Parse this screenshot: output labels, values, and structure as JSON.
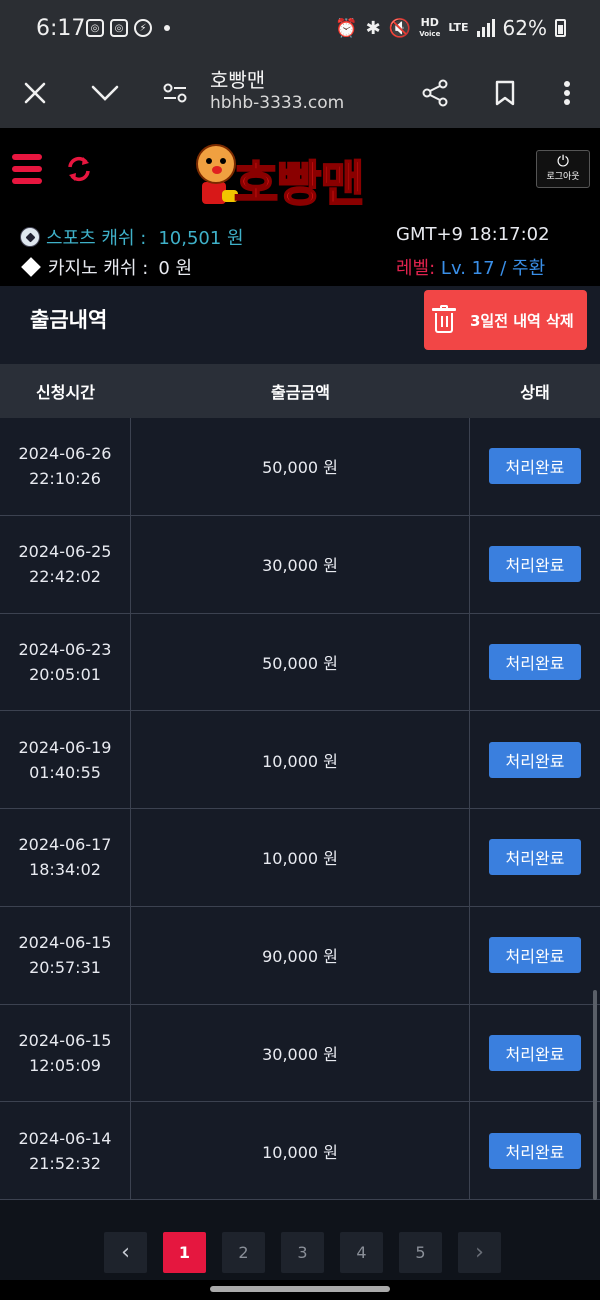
{
  "status_bar": {
    "time": "6:17",
    "hd_label": "HD",
    "voice_label": "Voice",
    "lte_label": "LTE",
    "battery": "62%"
  },
  "browser": {
    "title": "호빵맨",
    "url": "hbhb-3333.com"
  },
  "header": {
    "logo_text": "호빵맨",
    "logout_label": "로그아웃",
    "sports_cash_label": "스포츠 캐쉬 :",
    "sports_cash_value": "10,501 원",
    "casino_cash_label": "카지노 캐쉬 :",
    "casino_cash_value": "0 원",
    "clock": "GMT+9 18:17:02",
    "level_label": "레벨:",
    "level_value": "Lv. 17 / 주환"
  },
  "page": {
    "title": "출금내역",
    "delete_button": "3일전 내역 삭제"
  },
  "table": {
    "headers": [
      "신청시간",
      "출금금액",
      "상태"
    ],
    "rows": [
      {
        "date": "2024-06-26",
        "time": "22:10:26",
        "amount": "50,000 원",
        "status": "처리완료"
      },
      {
        "date": "2024-06-25",
        "time": "22:42:02",
        "amount": "30,000 원",
        "status": "처리완료"
      },
      {
        "date": "2024-06-23",
        "time": "20:05:01",
        "amount": "50,000 원",
        "status": "처리완료"
      },
      {
        "date": "2024-06-19",
        "time": "01:40:55",
        "amount": "10,000 원",
        "status": "처리완료"
      },
      {
        "date": "2024-06-17",
        "time": "18:34:02",
        "amount": "10,000 원",
        "status": "처리완료"
      },
      {
        "date": "2024-06-15",
        "time": "20:57:31",
        "amount": "90,000 원",
        "status": "처리완료"
      },
      {
        "date": "2024-06-15",
        "time": "12:05:09",
        "amount": "30,000 원",
        "status": "처리완료"
      },
      {
        "date": "2024-06-14",
        "time": "21:52:32",
        "amount": "10,000 원",
        "status": "처리완료"
      }
    ]
  },
  "pagination": {
    "prev": "‹",
    "pages": [
      "1",
      "2",
      "3",
      "4",
      "5"
    ],
    "active_page": "1",
    "next": "›"
  },
  "colors": {
    "accent_red": "#e5173f",
    "status_blue": "#3a7fde",
    "teal": "#3fb1c9"
  },
  "icons": [
    "close-icon",
    "chevron-down-icon",
    "page-settings-icon",
    "share-icon",
    "bookmark-icon",
    "more-vert-icon",
    "menu-icon",
    "refresh-icon",
    "power-icon",
    "soccer-ball-icon",
    "diamond-icon",
    "trash-icon"
  ]
}
